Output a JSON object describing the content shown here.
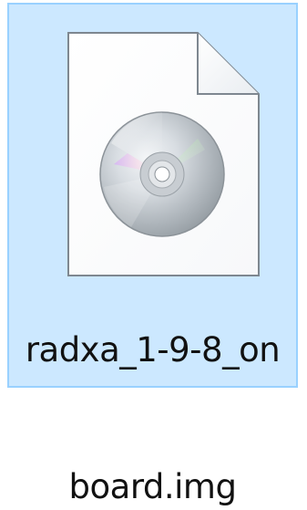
{
  "file": {
    "name_line_1": "radxa_1-9-8_on",
    "name_line_2": "board.img",
    "icon": "disc-image-file-icon",
    "selected": true
  },
  "colors": {
    "selection_background": "#cce8ff",
    "selection_border": "#99d1ff",
    "label_text": "#111111"
  }
}
